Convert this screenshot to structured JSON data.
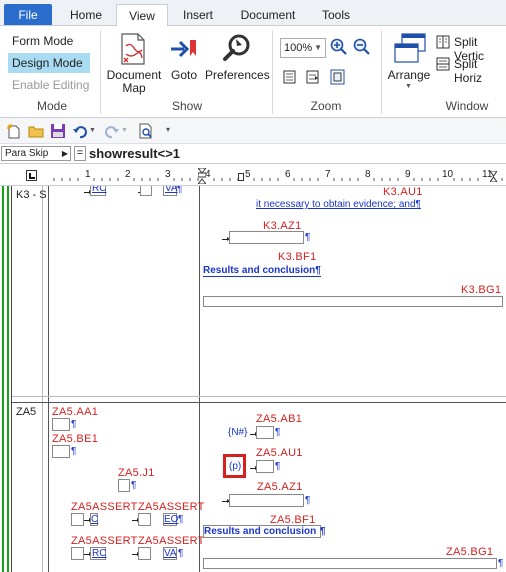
{
  "tabs": [
    {
      "label": "File"
    },
    {
      "label": "Home"
    },
    {
      "label": "View"
    },
    {
      "label": "Insert"
    },
    {
      "label": "Document"
    },
    {
      "label": "Tools"
    }
  ],
  "ribbon": {
    "mode": {
      "form_mode": "Form Mode",
      "design_mode": "Design Mode",
      "enable_editing": "Enable Editing",
      "group_label": "Mode"
    },
    "show": {
      "document_map_line1": "Document",
      "document_map_line2": "Map",
      "goto": "Goto",
      "preferences": "Preferences",
      "group_label": "Show"
    },
    "zoom": {
      "value": "100%",
      "group_label": "Zoom"
    },
    "window": {
      "arrange": "Arrange",
      "split_vertical": "Split Vertic",
      "split_horizontal": "Split Horiz",
      "group_label": "Window"
    }
  },
  "formula_bar": {
    "name_box": "Para Skip",
    "equals": "=",
    "expression": "showresult<>1"
  },
  "ruler": {
    "ticks": [
      "1",
      "2",
      "3",
      "4",
      "5",
      "6",
      "7",
      "8",
      "9",
      "10",
      "11"
    ]
  },
  "document": {
    "row1": {
      "left_label": "K3 - S",
      "left_fields": [
        "RC",
        "VA"
      ],
      "right": {
        "au1_code": "K3.AU1",
        "au1_text": "it necessary to obtain evidence; and¶",
        "az1_code": "K3.AZ1",
        "bf1_code": "K3.BF1",
        "bf1_text": "Results and conclusion¶",
        "bg1_code": "K3.BG1"
      }
    },
    "row2": {
      "left_label": "ZA5",
      "aa1_code": "ZA5.AA1",
      "be1_code": "ZA5.BE1",
      "j1_code": "ZA5.J1",
      "assert1a": "ZA5ASSERT",
      "assert1b": "ZA5ASSERT",
      "assert1_fields": [
        "C",
        "EO"
      ],
      "assert2a": "ZA5ASSERT",
      "assert2b": "ZA5ASSERT",
      "assert2_fields": [
        "RC",
        "VA"
      ],
      "ab1_code": "ZA5.AB1",
      "ab1_prefix": "{N#}",
      "au1_code": "ZA5.AU1",
      "au1_prefix": "(p)",
      "az1_code": "ZA5.AZ1",
      "bf1_code": "ZA5.BF1",
      "bf1_text": "Results and conclusion",
      "bg1_code": "ZA5.BG1"
    },
    "pilcrow": "¶"
  },
  "colors": {
    "accent": "#2b6dcc",
    "selected_mode": "#a9dcf3",
    "field_code": "#d42020",
    "field_text": "#1a35c9",
    "highlight_box": "#d42020"
  }
}
